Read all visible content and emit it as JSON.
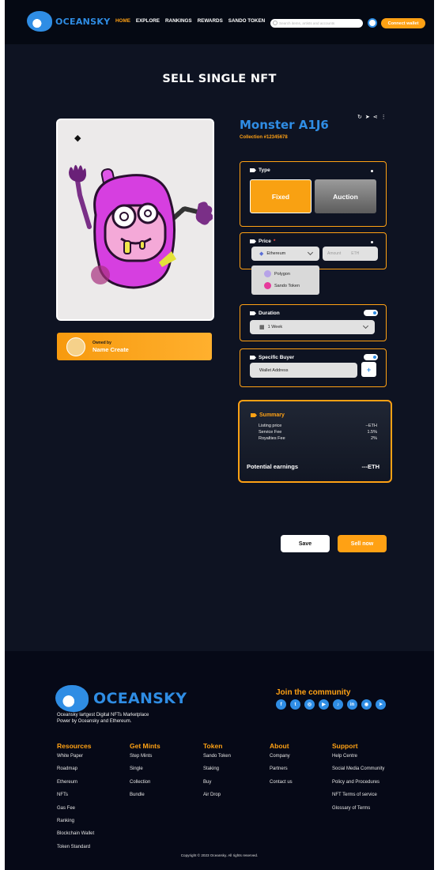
{
  "brand": {
    "name": "OCEANSKY"
  },
  "nav": {
    "items": [
      "HOME",
      "EXPLORE",
      "RANKINGS",
      "REWARDS",
      "SANDO TOKEN"
    ],
    "search_placeholder": "Search items, artists and accounts",
    "connect_label": "Connect wallet"
  },
  "page": {
    "title": "SELL SINGLE NFT"
  },
  "nft": {
    "name": "Monster A1J6",
    "collection": "Collection #12345678",
    "eth_symbol": "◆",
    "owner_label": "Owned by",
    "owner_name": "Name Create"
  },
  "form": {
    "type_label": "Type",
    "fixed_label": "Fixed",
    "auction_label": "Auction",
    "price_label": "Price",
    "price_required": "*",
    "currency_selected": "Ethereum",
    "amount_placeholder": "Amount",
    "amount_unit": "ETH",
    "currency_options": [
      "Polygon",
      "Sando Token"
    ],
    "duration_label": "Duration",
    "duration_value": "1 Week",
    "buyer_label": "Specific Buyer",
    "wallet_placeholder": "Wallet Address",
    "plus_label": "+"
  },
  "summary": {
    "label": "Summary",
    "rows": [
      {
        "k": "Listing price",
        "v": "--ETH"
      },
      {
        "k": "Service Fee",
        "v": "1.5%"
      },
      {
        "k": "Royalties Fee",
        "v": "2%"
      }
    ],
    "potential_label": "Potential earnings",
    "potential_value": "---ETH"
  },
  "actions": {
    "save": "Save",
    "sell_now": "Sell now"
  },
  "footer": {
    "brand": "OCEANSKY",
    "desc1": "Oceansky lartgest Digital NFTs Marketplace",
    "desc2": "Power by Oceansky and Ethereum.",
    "join": "Join the community",
    "columns": [
      {
        "title": "Resources",
        "links": [
          "White Paper",
          "Roadmap",
          "Ethereum",
          "NFTs",
          "Gas Fee",
          "Ranking",
          "Blockchain Wallet",
          "Token Standard"
        ]
      },
      {
        "title": "Get Mints",
        "links": [
          "Step Mints",
          "Single",
          "Collection",
          "Bundle"
        ]
      },
      {
        "title": "Token",
        "links": [
          "Sando Token",
          "Staking",
          "Buy",
          "Air Drop"
        ]
      },
      {
        "title": "About",
        "links": [
          "Company",
          "Partners",
          "Contact us"
        ]
      },
      {
        "title": "Support",
        "links": [
          "Help Centre",
          "Social Media Community",
          "Policy and Procedures",
          "NFT Terms of service",
          "Glossary of Terms"
        ]
      }
    ],
    "copyright": "Copyright © 2023 Oceansky. All rights reserved."
  },
  "colors": {
    "accent": "#ffa114",
    "brand_blue": "#2f8de4",
    "background": "#0e1322"
  }
}
